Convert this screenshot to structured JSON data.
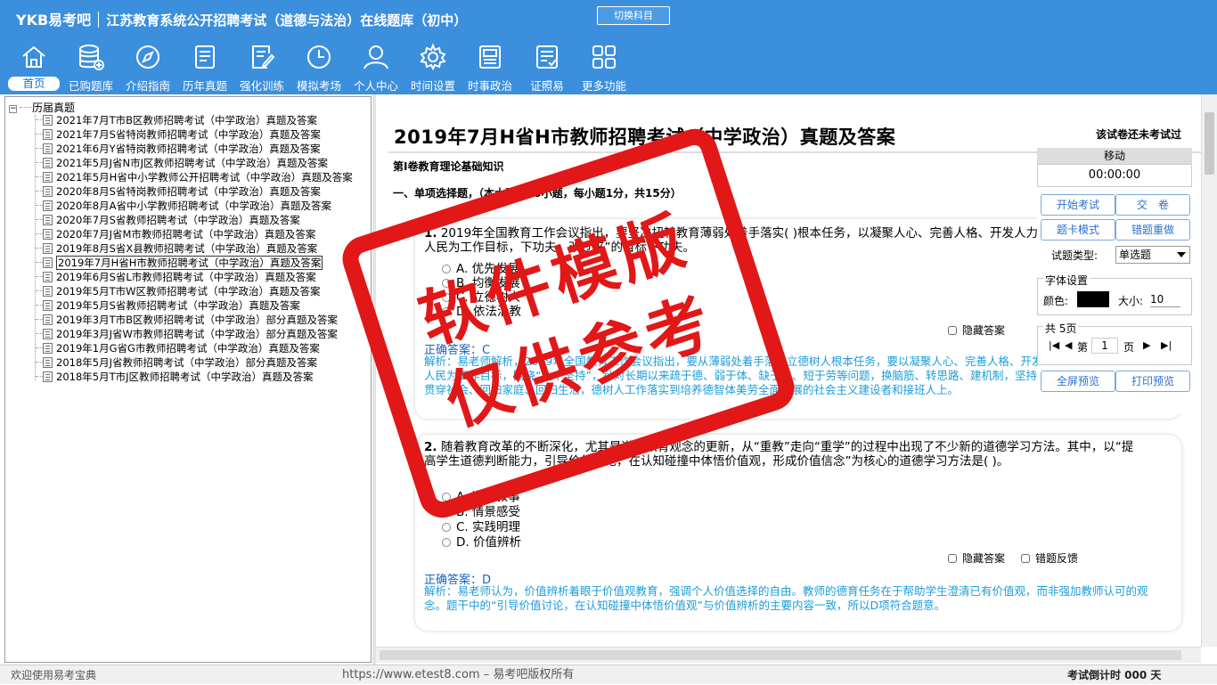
{
  "header": {
    "logo": "YKB易考吧",
    "app_title": "江苏教育系统公开招聘考试（道德与法治）在线题库（初中）",
    "switch_button": "切换科目"
  },
  "nav": [
    {
      "label": "首页",
      "icon": "home-icon",
      "active": true
    },
    {
      "label": "已购题库",
      "icon": "database-icon"
    },
    {
      "label": "介绍指南",
      "icon": "compass-icon"
    },
    {
      "label": "历年真题",
      "icon": "document-list-icon"
    },
    {
      "label": "强化训练",
      "icon": "edit-document-icon"
    },
    {
      "label": "模拟考场",
      "icon": "clock-icon"
    },
    {
      "label": "个人中心",
      "icon": "user-icon"
    },
    {
      "label": "时间设置",
      "icon": "gear-icon"
    },
    {
      "label": "时事政治",
      "icon": "newspaper-icon"
    },
    {
      "label": "证照易",
      "icon": "certificate-icon"
    },
    {
      "label": "更多功能",
      "icon": "grid-icon"
    }
  ],
  "tree": {
    "root": "历届真题",
    "items": [
      "2021年7月T市B区教师招聘考试（中学政治）真题及答案",
      "2021年7月S省特岗教师招聘考试（中学政治）真题及答案",
      "2021年6月Y省特岗教师招聘考试（中学政治）真题及答案",
      "2021年5月J省N市J区教师招聘考试（中学政治）真题及答案",
      "2021年5月H省中小学教师公开招聘考试（中学政治）真题及答案",
      "2020年8月S省特岗教师招聘考试（中学政治）真题及答案",
      "2020年8月A省中小学教师招聘考试（中学政治）真题及答案",
      "2020年7月S省教师招聘考试（中学政治）真题及答案",
      "2020年7月J省M市教师招聘考试（中学政治）真题及答案",
      "2019年8月S省X县教师招聘考试（中学政治）真题及答案",
      "2019年7月H省H市教师招聘考试（中学政治）真题及答案",
      "2019年6月S省L市教师招聘考试（中学政治）真题及答案",
      "2019年5月T市W区教师招聘考试（中学政治）真题及答案",
      "2019年5月S省教师招聘考试（中学政治）真题及答案",
      "2019年3月T市B区教师招聘考试（中学政治）部分真题及答案",
      "2019年3月J省W市教师招聘考试（中学政治）部分真题及答案",
      "2019年1月G省G市教师招聘考试（中学政治）真题及答案",
      "2018年5月J省教师招聘考试（中学政治）部分真题及答案",
      "2018年5月T市J区教师招聘考试（中学政治）真题及答案"
    ],
    "selected_index": 10
  },
  "paper": {
    "title": "2019年7月H省H市教师招聘考试（中学政治）真题及答案",
    "status": "该试卷还未考试过",
    "section": "第Ⅰ卷教育理论基础知识",
    "subsection": "一、单项选择题，（本大题共15小题，每小题1分，共15分）"
  },
  "questions": [
    {
      "number": "1.",
      "text": "2019年全国教育工作会议指出，要坚决扭转教育薄弱处着手落实( )根本任务，以凝聚人心、完善人格、开发人力、培育人才、造福人民为工作目标，下功夫。改过来”的目标下功夫。",
      "options": [
        "A. 优先发展",
        "B. 均衡发展",
        "C. 立德树人",
        "D. 依法治教"
      ],
      "hide_answer": "隐藏答案",
      "answer_label": "正确答案：C",
      "explanation": "解析：易老师解析，2019年全国教育工作会议指出，要从薄弱处着手落实立德树人根本任务，要以凝聚人心、完善人格、开发人力、培育人才、造福人民为工作目标，围绕“九个坚持”，针对长期以来疏于德、弱于体、缺于美、短于劳等问题，换脑筋、转思路、建机制，坚持以德为先，让立德树人贯穿社会、回归家庭、回归生活，德树人工作落实到培养德智体美劳全面发展的社会主义建设者和接班人上。"
    },
    {
      "number": "2.",
      "text": "随着教育改革的不断深化，尤其是道德教育观念的更新，从“重教”走向“重学”的过程中出现了不少新的道德学习方法。其中，以“提高学生道德判断能力，引导价值讨论，在认知碰撞中体悟价值观，形成价值信念”为核心的道德学习方法是( )。",
      "options": [
        "A. 道德叙事",
        "B. 情景感受",
        "C. 实践明理",
        "D. 价值辨析"
      ],
      "hide_answer": "隐藏答案",
      "feedback": "错题反馈",
      "answer_label": "正确答案：",
      "answer_value": "D",
      "explanation": "解析：易老师认为，价值辨析着眼于价值观教育，强调个人价值选择的自由。教师的德育任务在于帮助学生澄清已有价值观，而非强加教师认可的观念。题干中的“引导价值讨论，在认知碰撞中体悟价值观”与价值辨析的主要内容一致，所以D项符合题意。"
    }
  ],
  "side": {
    "move": "移动",
    "timer": "00:00:00",
    "start_exam": "开始考试",
    "submit": "交　卷",
    "card_mode": "题卡模式",
    "redo_wrong": "错题重做",
    "qtype_label": "试题类型:",
    "qtype_value": "单选题",
    "font_title": "字体设置",
    "color_label": "颜色:",
    "font_color": "#000000",
    "size_label": "大小:",
    "size_value": "10",
    "pages_title": "共 5页",
    "page_prefix": "第",
    "page_value": "1",
    "page_suffix": "页",
    "fullscreen": "全屏预览",
    "print": "打印预览"
  },
  "statusbar": {
    "welcome": "欢迎使用易考宝典",
    "copyright": "https://www.etest8.com – 易考吧版权所有",
    "countdown": "考试倒计时 000 天"
  },
  "watermark": {
    "line1": "软件模版",
    "line2": "仅供参考"
  },
  "colors": {
    "brand_blue": "#3b8fdd",
    "stamp_red": "#e21717",
    "answer_blue": "#1a5fbf",
    "explanation_blue": "#1c9dd8"
  }
}
